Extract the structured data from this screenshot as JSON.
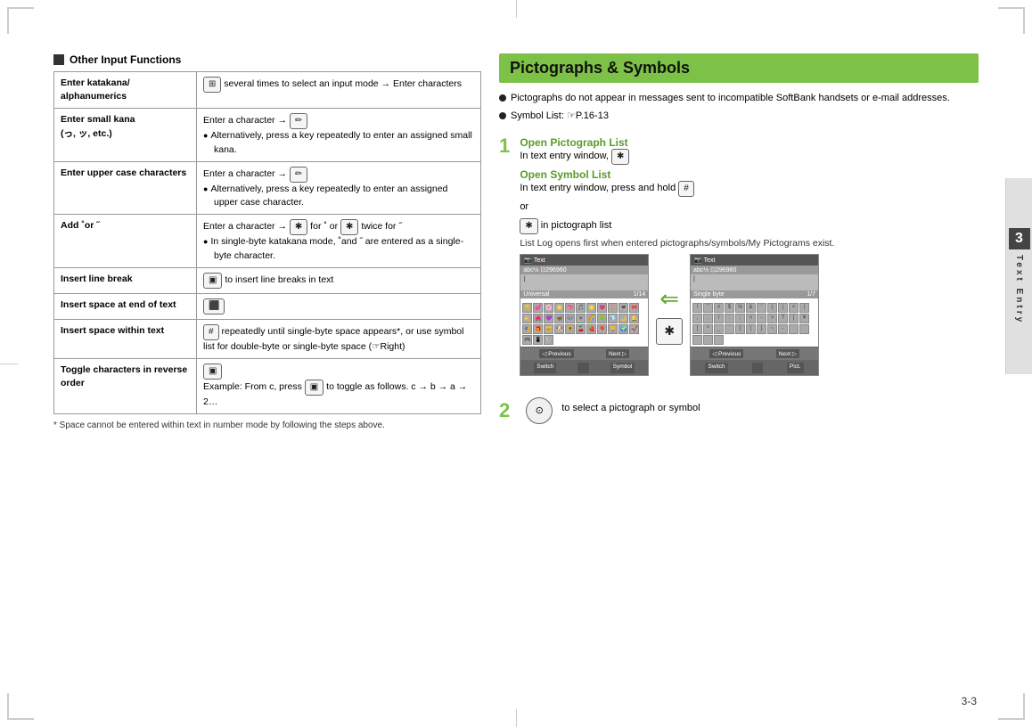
{
  "page": {
    "number": "3-3",
    "corners": true
  },
  "left": {
    "section_title": "Other Input Functions",
    "table": {
      "rows": [
        {
          "label": "Enter katakana/\nalphanumerics",
          "content": "several times to select an input mode → Enter characters",
          "has_icon": true,
          "icon": "⊞",
          "bullets": []
        },
        {
          "label": "Enter small kana\n(っ, ッ, etc.)",
          "content": "Enter a character →",
          "has_icon": true,
          "icon": "✏",
          "bullets": [
            "Alternatively, press a key repeatedly to enter an assigned small kana."
          ]
        },
        {
          "label": "Enter upper case characters",
          "content": "Enter a character →",
          "has_icon": true,
          "icon": "✏",
          "bullets": [
            "Alternatively, press a key repeatedly to enter an assigned upper case character."
          ]
        },
        {
          "label": "Add ˚or ˝",
          "content": "Enter a character → ⊛ for ˚ or ⊛ twice for ˝",
          "has_icon": false,
          "bullets": [
            "In single-byte katakana mode, ˚and ˝ are entered as a single-byte character."
          ]
        },
        {
          "label": "Insert line break",
          "content": "to insert line breaks in text",
          "has_icon": true,
          "icon": "⬛",
          "bullets": []
        },
        {
          "label": "Insert space at end of text",
          "content": "",
          "has_icon": true,
          "icon": "⬛",
          "bullets": []
        },
        {
          "label": "Insert space within text",
          "content": "repeatedly until single-byte space appears*, or use symbol list for double-byte or single-byte space (☞Right)",
          "has_icon": true,
          "icon": "#",
          "bullets": []
        },
        {
          "label": "Toggle characters in reverse order",
          "content": "",
          "has_icon": true,
          "icon": "⬛",
          "bullets": [],
          "extra": "Example: From c, press ⬛ to toggle as follows. c → b → a → 2…"
        }
      ]
    },
    "footnote": "* Space cannot be entered within text in number mode by following the steps above."
  },
  "right": {
    "header_title": "Pictographs & Symbols",
    "bullets": [
      "Pictographs do not appear in messages sent to incompatible SoftBank handsets or e-mail addresses.",
      "Symbol List: ☞P.16-13"
    ],
    "steps": [
      {
        "num": "1",
        "label": "Open Pictograph List",
        "text": "In text entry window, ⊛",
        "sublabel": "Open Symbol List",
        "subtext": "In text entry window, press and hold #",
        "or_text": "or",
        "or_subtext": "⊛ in pictograph list",
        "note": "List Log opens first when entered pictographs/symbols/My Pictograms exist."
      },
      {
        "num": "2",
        "text": "to select a pictograph or symbol",
        "icon": "⊙"
      }
    ],
    "phone_left": {
      "titlebar": "Text",
      "statusbar": "abc½  ⊡296960",
      "tab": "Universal  1/14",
      "footer_left": "Previous",
      "footer_mid": "Next",
      "footer_sw": "Switch",
      "footer_sym": "Symbol"
    },
    "phone_right": {
      "titlebar": "Text",
      "statusbar": "abc½  ⊡296960",
      "tab": "Single byte  1/7",
      "symbols": "! \" # $ % & ' ( ) × | , . / : ; < - > ¿ [ ¥ ] ^ _ ` { | } ~ -",
      "footer_left": "Previous",
      "footer_mid": "Next",
      "footer_sw": "Switch",
      "footer_pict": "Pict."
    }
  },
  "sidebar": {
    "number": "3",
    "label": "Text Entry"
  }
}
